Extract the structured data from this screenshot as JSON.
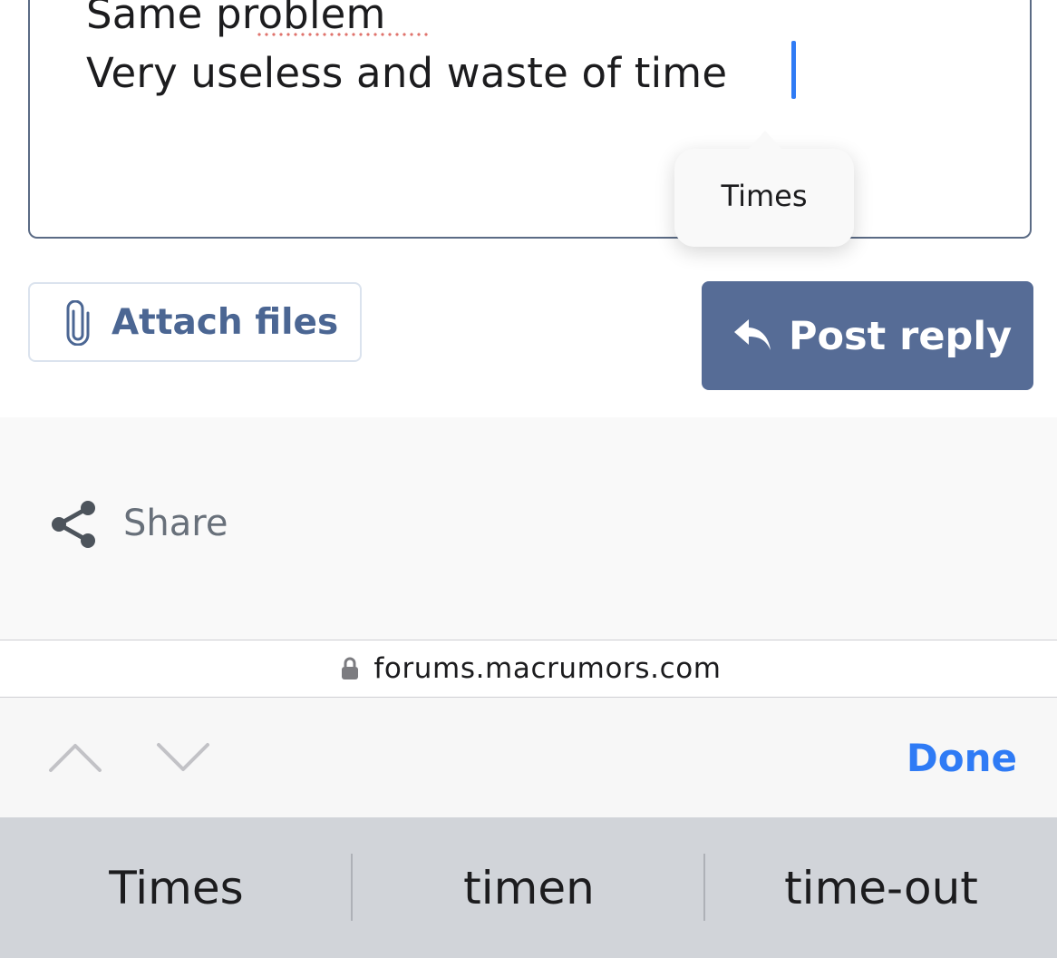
{
  "editor": {
    "line1": "Same problem",
    "line2": "Very useless and waste of time"
  },
  "autocorrect": {
    "suggestion": "Times"
  },
  "buttons": {
    "attach_label": "Attach files",
    "reply_label": "Post reply"
  },
  "share": {
    "label": "Share"
  },
  "browser": {
    "url": "forums.macrumors.com"
  },
  "accessory": {
    "done_label": "Done"
  },
  "predictive": {
    "items": [
      "Times",
      "timen",
      "time-out"
    ]
  },
  "colors": {
    "accent_blue": "#2f7bf5",
    "button_primary": "#566c96",
    "button_text_link": "#4b6693",
    "keyboard_bg": "#d1d4d9"
  }
}
